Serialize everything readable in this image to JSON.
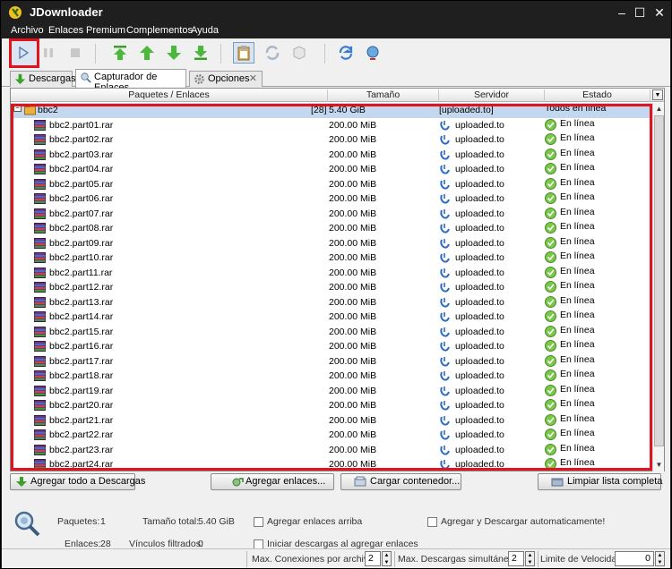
{
  "window": {
    "title": "JDownloader"
  },
  "menu": [
    "Archivo",
    "Enlaces",
    "Premium",
    "Complementos",
    "Ayuda"
  ],
  "tabs": [
    {
      "label": "Descargas",
      "icon": "download-arrow-icon"
    },
    {
      "label": "Capturador de Enlaces",
      "icon": "link-grabber-icon"
    },
    {
      "label": "Opciones",
      "icon": "gear-icon"
    }
  ],
  "table": {
    "columns": [
      "Paquetes / Enlaces",
      "Tamaño",
      "Servidor",
      "Estado"
    ],
    "package": {
      "name": "bbc2",
      "count": "[28]",
      "size": "5.40 GiB",
      "host": "[uploaded.to]",
      "status": "Todos en línea"
    },
    "links": [
      {
        "name": "bbc2.part01.rar",
        "size": "200.00 MiB",
        "host": "uploaded.to",
        "status": "En línea"
      },
      {
        "name": "bbc2.part02.rar",
        "size": "200.00 MiB",
        "host": "uploaded.to",
        "status": "En línea"
      },
      {
        "name": "bbc2.part03.rar",
        "size": "200.00 MiB",
        "host": "uploaded.to",
        "status": "En línea"
      },
      {
        "name": "bbc2.part04.rar",
        "size": "200.00 MiB",
        "host": "uploaded.to",
        "status": "En línea"
      },
      {
        "name": "bbc2.part05.rar",
        "size": "200.00 MiB",
        "host": "uploaded.to",
        "status": "En línea"
      },
      {
        "name": "bbc2.part06.rar",
        "size": "200.00 MiB",
        "host": "uploaded.to",
        "status": "En línea"
      },
      {
        "name": "bbc2.part07.rar",
        "size": "200.00 MiB",
        "host": "uploaded.to",
        "status": "En línea"
      },
      {
        "name": "bbc2.part08.rar",
        "size": "200.00 MiB",
        "host": "uploaded.to",
        "status": "En línea"
      },
      {
        "name": "bbc2.part09.rar",
        "size": "200.00 MiB",
        "host": "uploaded.to",
        "status": "En línea"
      },
      {
        "name": "bbc2.part10.rar",
        "size": "200.00 MiB",
        "host": "uploaded.to",
        "status": "En línea"
      },
      {
        "name": "bbc2.part11.rar",
        "size": "200.00 MiB",
        "host": "uploaded.to",
        "status": "En línea"
      },
      {
        "name": "bbc2.part12.rar",
        "size": "200.00 MiB",
        "host": "uploaded.to",
        "status": "En línea"
      },
      {
        "name": "bbc2.part13.rar",
        "size": "200.00 MiB",
        "host": "uploaded.to",
        "status": "En línea"
      },
      {
        "name": "bbc2.part14.rar",
        "size": "200.00 MiB",
        "host": "uploaded.to",
        "status": "En línea"
      },
      {
        "name": "bbc2.part15.rar",
        "size": "200.00 MiB",
        "host": "uploaded.to",
        "status": "En línea"
      },
      {
        "name": "bbc2.part16.rar",
        "size": "200.00 MiB",
        "host": "uploaded.to",
        "status": "En línea"
      },
      {
        "name": "bbc2.part17.rar",
        "size": "200.00 MiB",
        "host": "uploaded.to",
        "status": "En línea"
      },
      {
        "name": "bbc2.part18.rar",
        "size": "200.00 MiB",
        "host": "uploaded.to",
        "status": "En línea"
      },
      {
        "name": "bbc2.part19.rar",
        "size": "200.00 MiB",
        "host": "uploaded.to",
        "status": "En línea"
      },
      {
        "name": "bbc2.part20.rar",
        "size": "200.00 MiB",
        "host": "uploaded.to",
        "status": "En línea"
      },
      {
        "name": "bbc2.part21.rar",
        "size": "200.00 MiB",
        "host": "uploaded.to",
        "status": "En línea"
      },
      {
        "name": "bbc2.part22.rar",
        "size": "200.00 MiB",
        "host": "uploaded.to",
        "status": "En línea"
      },
      {
        "name": "bbc2.part23.rar",
        "size": "200.00 MiB",
        "host": "uploaded.to",
        "status": "En línea"
      },
      {
        "name": "bbc2.part24.rar",
        "size": "200.00 MiB",
        "host": "uploaded.to",
        "status": "En línea"
      }
    ]
  },
  "buttons": {
    "add_all": "Agregar todo a Descargas",
    "add_links": "Agregar enlaces...",
    "load_container": "Cargar contenedor...",
    "clear_list": "Limpiar lista completa"
  },
  "info": {
    "packages_label": "Paquetes:",
    "packages_value": "1",
    "links_label": "Enlaces:",
    "links_value": "28",
    "total_size_label": "Tamaño total:",
    "total_size_value": "5.40 GiB",
    "filtered_label": "Vínculos filtrados:",
    "filtered_value": "0",
    "opt_add_top": "Agregar enlaces arriba",
    "opt_start_on_add": "Iniciar descargas al agregar enlaces",
    "opt_auto_add": "Agregar y Descargar automaticamente!"
  },
  "status": {
    "max_conn_label": "Max. Conexiones por archivo",
    "max_conn_value": "2",
    "max_dl_label": "Max. Descargas simultáneas",
    "max_dl_value": "2",
    "speed_label": "Limite de Velocidad",
    "speed_value": "0"
  },
  "colors": {
    "highlight": "#e0141e",
    "selection": "#c3d8ee",
    "titlebar": "#1f1f1f"
  }
}
